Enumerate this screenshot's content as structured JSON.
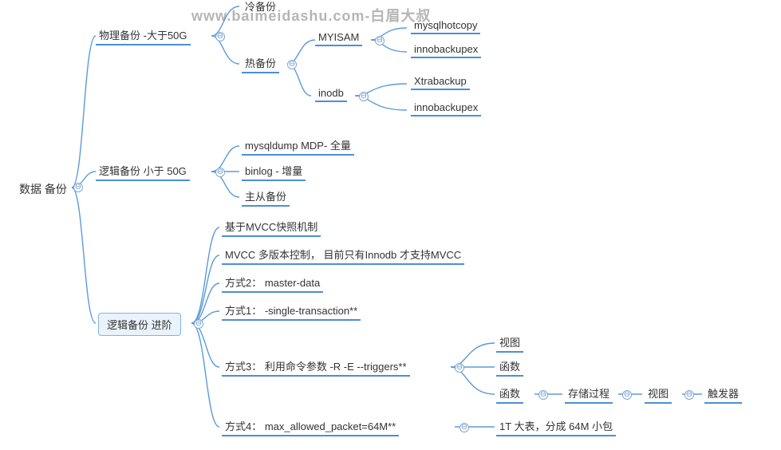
{
  "watermark": "www.baimeidashu.com-白眉大叔",
  "root": "数据 备份",
  "b1": {
    "label": "物理备份 -大于50G",
    "c1": "冷备份",
    "c2": "热备份",
    "c2a": "MYISAM",
    "c2a1": "mysqlhotcopy",
    "c2a2": "innobackupex",
    "c2b": "inodb",
    "c2b1": "Xtrabackup",
    "c2b2": "innobackupex"
  },
  "b2": {
    "label": "逻辑备份 小于 50G",
    "c1": "mysqldump  MDP- 全量",
    "c2": "binlog - 增量",
    "c3": "主从备份"
  },
  "b3": {
    "label": "逻辑备份 进阶",
    "c1": "基于MVCC快照机制",
    "c2": "MVCC 多版本控制， 目前只有Innodb 才支持MVCC",
    "c3": "方式2： master-data",
    "c4": "方式1： -single-transaction**",
    "c5": "方式3： 利用命令参数 -R -E --triggers**",
    "c5a": "视图",
    "c5b": "函数",
    "c5c": "函数",
    "c5c1": "存储过程",
    "c5c2": "视图",
    "c5c3": "触发器",
    "c6": "方式4： max_allowed_packet=64M**",
    "c6a": "1T 大表，分成 64M 小包"
  },
  "toggle": "⊖"
}
